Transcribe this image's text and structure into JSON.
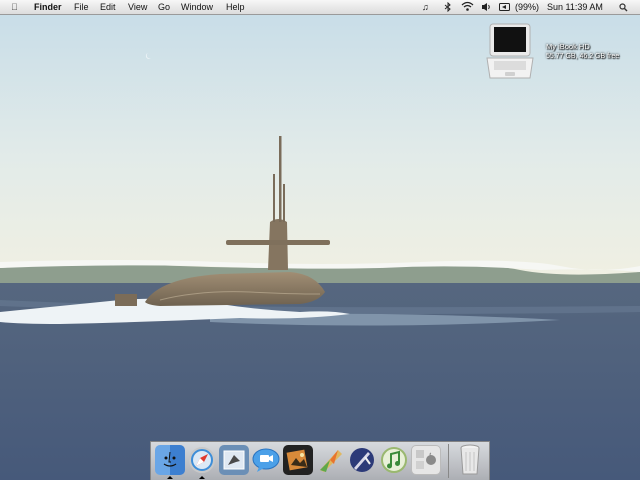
{
  "menubar": {
    "apple_icon": "apple-icon",
    "app_name": "Finder",
    "menus": [
      "File",
      "Edit",
      "View",
      "Go",
      "Window",
      "Help"
    ],
    "status": {
      "music_icon": "music-note-icon",
      "bluetooth_icon": "bluetooth-icon",
      "wifi_icon": "wifi-icon",
      "volume_icon": "volume-icon",
      "battery_icon": "battery-icon",
      "battery_text": "(99%)",
      "clock": "Sun 11:39 AM",
      "spotlight_icon": "spotlight-icon"
    }
  },
  "desktop": {
    "disk_name": "My iBook HD",
    "disk_info": "55.77 GB, 46.2 GB free",
    "disk_icon": "laptop-drive-icon"
  },
  "dock": {
    "items": [
      {
        "icon": "finder-icon",
        "running": true
      },
      {
        "icon": "safari-icon",
        "running": true
      },
      {
        "icon": "mail-icon",
        "running": false
      },
      {
        "icon": "ichat-icon",
        "running": false
      },
      {
        "icon": "iphoto-icon",
        "running": false
      },
      {
        "icon": "ilife-icon",
        "running": false
      },
      {
        "icon": "address-book-icon",
        "running": false
      },
      {
        "icon": "itunes-icon",
        "running": false
      },
      {
        "icon": "system-preferences-icon",
        "running": false
      }
    ],
    "trash_icon": "trash-icon"
  },
  "colors": {
    "sky_top": "#c8dde8",
    "sky_bottom": "#eef0e4",
    "water": "#4c5f7c",
    "submarine": "#8c7a64"
  }
}
